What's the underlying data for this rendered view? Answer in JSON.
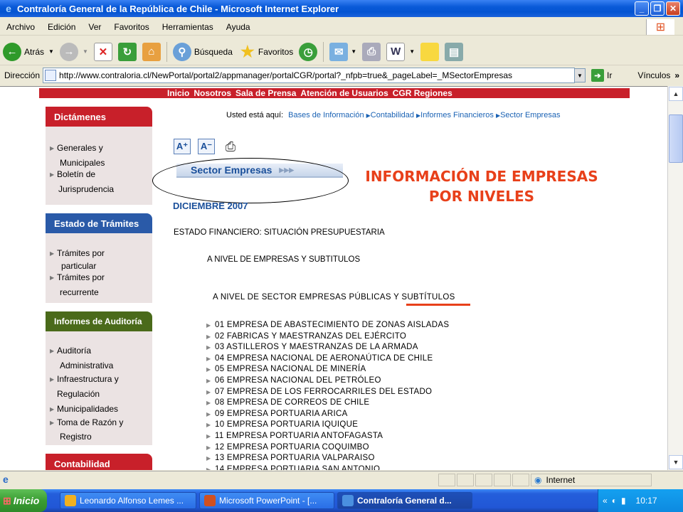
{
  "window": {
    "title": "Contraloría General de la República de Chile - Microsoft Internet Explorer",
    "buttons": [
      "_",
      "❐",
      "✕"
    ]
  },
  "menu": [
    "Archivo",
    "Edición",
    "Ver",
    "Favoritos",
    "Herramientas",
    "Ayuda"
  ],
  "toolbar": {
    "back": "Atrás",
    "search": "Búsqueda",
    "favorites": "Favoritos"
  },
  "address": {
    "label": "Dirección",
    "url": "http://www.contraloria.cl/NewPortal/portal2/appmanager/portalCGR/portal?_nfpb=true&_pageLabel=_MSectorEmpresas",
    "go": "Ir",
    "links": "Vínculos"
  },
  "page": {
    "topnav": [
      "Inicio",
      "Nosotros",
      "Sala de Prensa",
      "Atención de Usuarios",
      "CGR Regiones"
    ],
    "sidebar": [
      {
        "header": "Dictámenes",
        "color": "#c8202a",
        "items": [
          [
            "Generales y",
            "Municipales"
          ],
          [
            "Boletín de",
            "Jurisprudencia"
          ]
        ]
      },
      {
        "header": "Estado de Trámites",
        "color": "#2a5aa8",
        "items": [
          [
            "Trámites por",
            "particular"
          ],
          [
            "Trámites por",
            "recurrente"
          ]
        ]
      },
      {
        "header": "Informes de Auditoría",
        "color": "#4a6a1a",
        "items": [
          [
            "Auditoría",
            "Administrativa"
          ],
          [
            "Infraestructura y",
            "Regulación"
          ],
          [
            "Municipalidades",
            ""
          ],
          [
            "Toma de Razón y",
            "Registro"
          ]
        ]
      },
      {
        "header": "Contabilidad",
        "color": "#c8202a",
        "items": []
      }
    ],
    "breadcrumb": {
      "prefix": "Usted está aquí:",
      "items": [
        "Bases de Información",
        "Contabilidad",
        "Informes Financieros",
        "Sector Empresas"
      ]
    },
    "tools": {
      "increase": "A⁺",
      "decrease": "A⁻"
    },
    "sector_tab": "Sector Empresas",
    "big_title": [
      "INFORMACIÓN DE EMPRESAS",
      "POR NIVELES"
    ],
    "date": "DICIEMBRE 2007",
    "statement": "ESTADO FINANCIERO: SITUACIÓN PRESUPUESTARIA",
    "level": "A NIVEL DE EMPRESAS Y SUBTITULOS",
    "sector_level": "A NIVEL DE SECTOR EMPRESAS PÚBLICAS Y SUBTÍTULOS",
    "companies": [
      "01 EMPRESA DE ABASTECIMIENTO DE ZONAS AISLADAS",
      "02 FABRICAS Y MAESTRANZAS DEL EJÉRCITO",
      "03 ASTILLEROS Y MAESTRANZAS DE LA ARMADA",
      "04 EMPRESA NACIONAL DE AERONAÚTICA DE CHILE",
      "05 EMPRESA NACIONAL DE MINERÍA",
      "06 EMPRESA NACIONAL DEL PETRÓLEO",
      "07 EMPRESA DE LOS FERROCARRILES DEL ESTADO",
      "08 EMPRESA DE CORREOS DE CHILE",
      "09 EMPRESA PORTUARIA ARICA",
      "10 EMPRESA PORTUARIA IQUIQUE",
      "11 EMPRESA PORTUARIA ANTOFAGASTA",
      "12 EMPRESA PORTUARIA COQUIMBO",
      "13 EMPRESA PORTUARIA VALPARAISO",
      "14 EMPRESA PORTUARIA SAN ANTONIO"
    ]
  },
  "status": {
    "zone": "Internet"
  },
  "taskbar": {
    "start": "Inicio",
    "tasks": [
      "Leonardo Alfonso Lemes ...",
      "Microsoft PowerPoint - [...",
      "Contraloría General d..."
    ],
    "clock": "10:17"
  }
}
